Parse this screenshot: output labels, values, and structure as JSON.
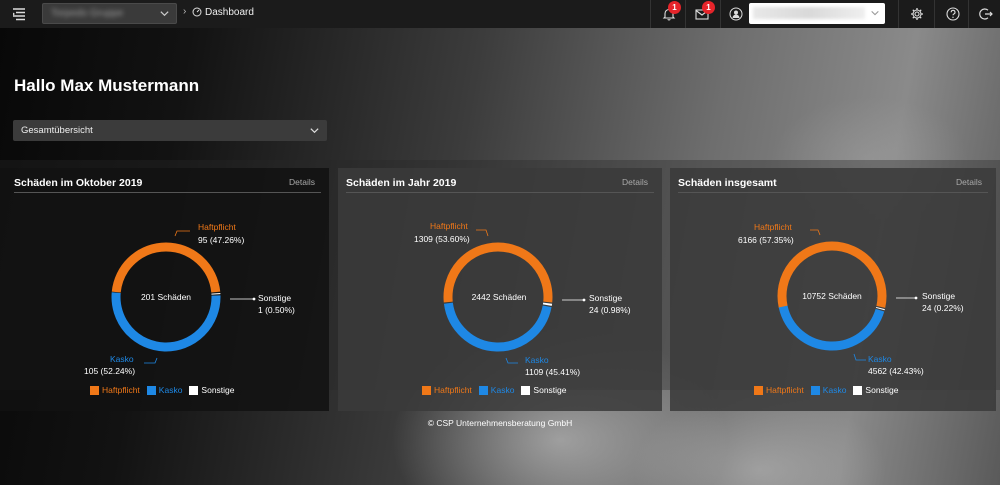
{
  "header": {
    "org_select": "Torpedo Gruppe",
    "breadcrumb": "Dashboard",
    "notifications_count": "1",
    "messages_count": "1",
    "user_select": ""
  },
  "greeting": "Hallo Max Mustermann",
  "overview_select": "Gesamtübersicht",
  "colors": {
    "haftpflicht": "#f07818",
    "kasko": "#1e88e5",
    "sonstige": "#ffffff"
  },
  "cards": [
    {
      "title": "Schäden im Oktober 2019",
      "details": "Details",
      "total_label": "201 Schäden",
      "haftpflicht_name": "Haftpflicht",
      "haftpflicht_value": "95 (47.26%)",
      "kasko_name": "Kasko",
      "kasko_value": "105 (52.24%)",
      "sonstige_name": "Sonstige",
      "sonstige_value": "1 (0.50%)"
    },
    {
      "title": "Schäden im Jahr 2019",
      "details": "Details",
      "total_label": "2442 Schäden",
      "haftpflicht_name": "Haftpflicht",
      "haftpflicht_value": "1309 (53.60%)",
      "kasko_name": "Kasko",
      "kasko_value": "1109 (45.41%)",
      "sonstige_name": "Sonstige",
      "sonstige_value": "24 (0.98%)"
    },
    {
      "title": "Schäden insgesamt",
      "details": "Details",
      "total_label": "10752 Schäden",
      "haftpflicht_name": "Haftpflicht",
      "haftpflicht_value": "6166 (57.35%)",
      "kasko_name": "Kasko",
      "kasko_value": "4562 (42.43%)",
      "sonstige_name": "Sonstige",
      "sonstige_value": "24 (0.22%)"
    }
  ],
  "legend": [
    "Haftpflicht",
    "Kasko",
    "Sonstige"
  ],
  "footer": "© CSP Unternehmensberatung GmbH",
  "chart_data": [
    {
      "type": "pie",
      "categories": [
        "Haftpflicht",
        "Kasko",
        "Sonstige"
      ],
      "values": [
        95,
        105,
        1
      ],
      "title": "Schäden im Oktober 2019"
    },
    {
      "type": "pie",
      "categories": [
        "Haftpflicht",
        "Kasko",
        "Sonstige"
      ],
      "values": [
        1309,
        1109,
        24
      ],
      "title": "Schäden im Jahr 2019"
    },
    {
      "type": "pie",
      "categories": [
        "Haftpflicht",
        "Kasko",
        "Sonstige"
      ],
      "values": [
        6166,
        4562,
        24
      ],
      "title": "Schäden insgesamt"
    }
  ]
}
